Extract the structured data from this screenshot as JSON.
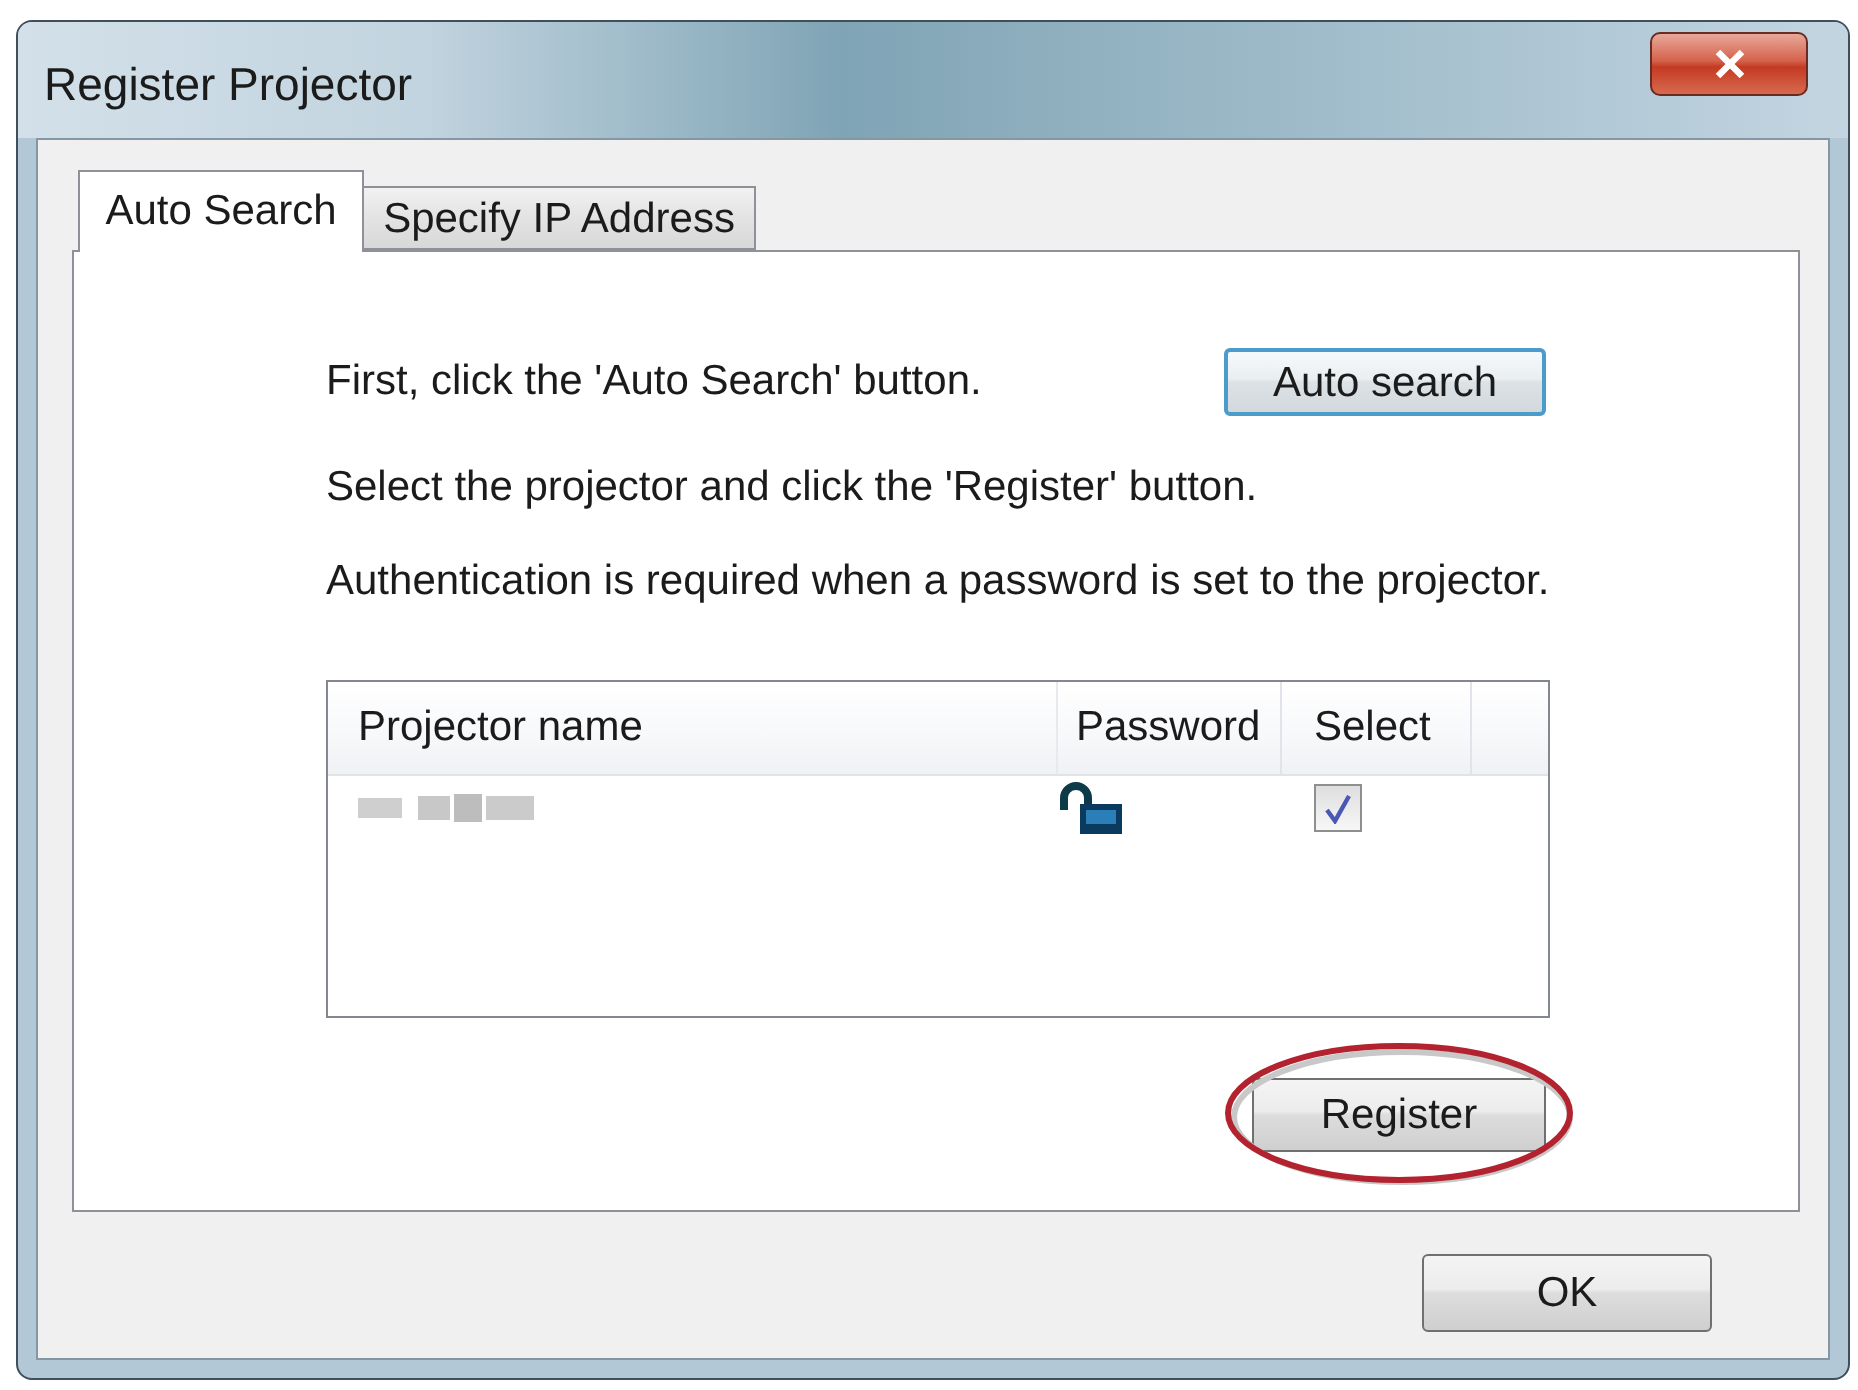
{
  "window": {
    "title": "Register Projector"
  },
  "tabs": [
    {
      "label": "Auto Search",
      "selected": true
    },
    {
      "label": "Specify IP Address",
      "selected": false
    }
  ],
  "step_1": {
    "text": "First, click the 'Auto Search' button.",
    "button": "Auto search",
    "focused": true
  },
  "instructions": [
    "Select the projector and click the 'Register' button.",
    "Authentication is required when a password is set to the projector."
  ],
  "projector_list": {
    "columns": [
      "Projector name",
      "Password",
      "Select"
    ],
    "rows": [
      {
        "name_redacted": true,
        "password_locked": false,
        "checked": true
      }
    ]
  },
  "register_button": {
    "label": "Register",
    "highlighted": true
  },
  "ok_button": "OK"
}
